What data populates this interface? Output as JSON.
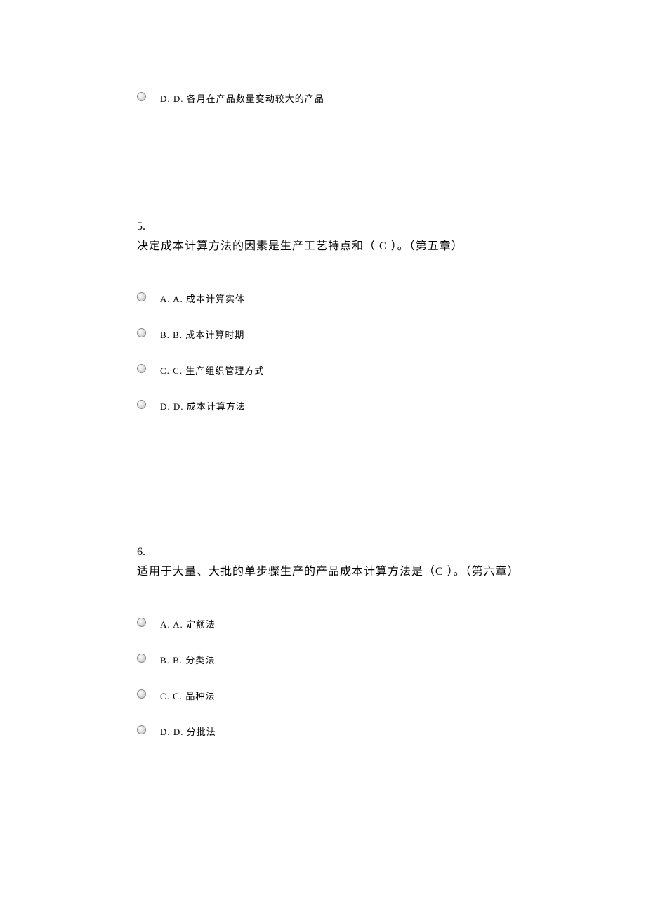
{
  "orphan_option": {
    "label": "D. D. 各月在产品数量变动较大的产品"
  },
  "q5": {
    "number": "5.",
    "text": "决定成本计算方法的因素是生产工艺特点和（  C  ）。（第五章）",
    "options": {
      "a": "A. A. 成本计算实体",
      "b": "B. B. 成本计算时期",
      "c": "C. C. 生产组织管理方式",
      "d": "D. D. 成本计算方法"
    }
  },
  "q6": {
    "number": "6.",
    "text": "适用于大量、大批的单步骤生产的产品成本计算方法是（C   ）。（第六章）",
    "options": {
      "a": "A. A. 定额法",
      "b": "B. B. 分类法",
      "c": "C. C. 品种法",
      "d": "D. D. 分批法"
    }
  }
}
